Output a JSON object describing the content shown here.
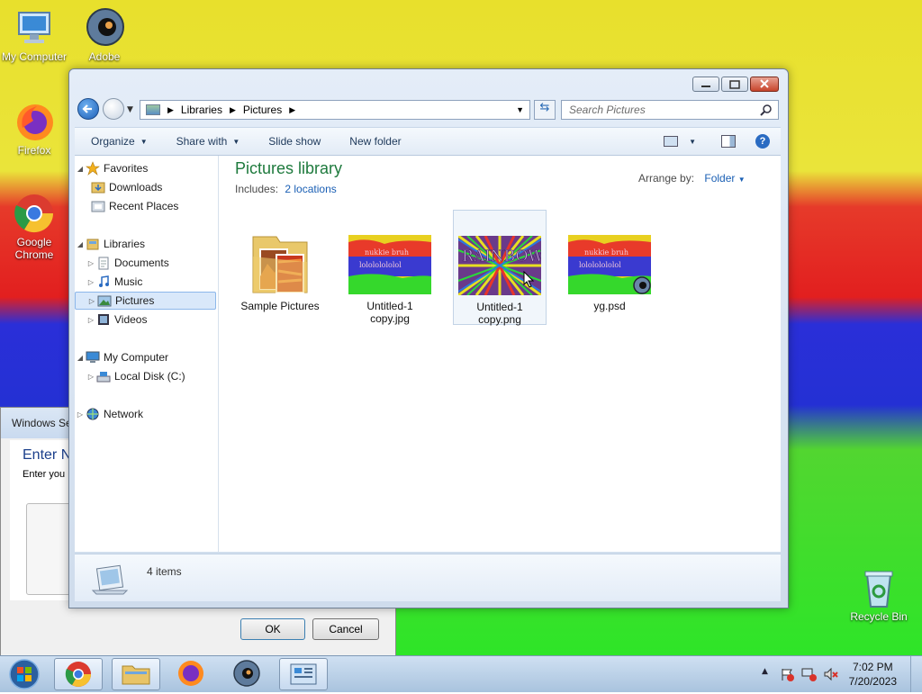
{
  "desktop": {
    "icons": [
      {
        "label": "My Computer",
        "icon": "computer-icon"
      },
      {
        "label": "Adobe",
        "icon": "adobe-icon"
      },
      {
        "label": "Firefox",
        "icon": "firefox-icon"
      },
      {
        "label": "Google Chrome",
        "icon": "chrome-icon"
      },
      {
        "label": "Recycle Bin",
        "icon": "recycle-bin-icon"
      }
    ]
  },
  "security_dialog": {
    "title": "Windows Se",
    "heading": "Enter N",
    "subtext": "Enter you",
    "ok_label": "OK",
    "cancel_label": "Cancel"
  },
  "explorer": {
    "breadcrumb": [
      "Libraries",
      "Pictures"
    ],
    "search_placeholder": "Search Pictures",
    "toolbar": {
      "organize": "Organize",
      "share_with": "Share with",
      "slide_show": "Slide show",
      "new_folder": "New folder"
    },
    "nav": {
      "favorites": "Favorites",
      "downloads": "Downloads",
      "recent_places": "Recent Places",
      "libraries": "Libraries",
      "documents": "Documents",
      "music": "Music",
      "pictures": "Pictures",
      "videos": "Videos",
      "my_computer": "My Computer",
      "local_disk": "Local Disk (C:)",
      "network": "Network"
    },
    "content": {
      "title": "Pictures library",
      "includes_label": "Includes:",
      "includes_link": "2 locations",
      "arrange_label": "Arrange by:",
      "arrange_value": "Folder",
      "thumb_text": "nukkie bruh",
      "thumb_text2": "lolololololol",
      "rainbow_text": "RAINBOW",
      "items": [
        {
          "name": "Sample Pictures"
        },
        {
          "name": "Untitled-1 copy.jpg"
        },
        {
          "name": "Untitled-1 copy.png"
        },
        {
          "name": "yg.psd"
        }
      ]
    },
    "status": {
      "count": "4 items"
    }
  },
  "taskbar": {
    "time": "7:02 PM",
    "date": "7/20/2023"
  },
  "colors": {
    "accent": "#1e7a3d",
    "link": "#1a5fb4"
  }
}
